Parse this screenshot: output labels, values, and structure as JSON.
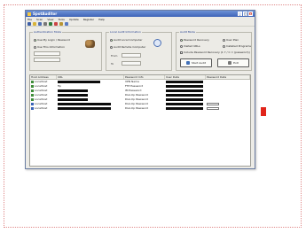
{
  "window": {
    "title": "SpotAuditor"
  },
  "menu": [
    "File",
    "Scan",
    "View",
    "Tools",
    "Update",
    "Register",
    "Help"
  ],
  "auth": {
    "title": "Authentication Mode",
    "opt_current": "Use My Login / Password",
    "opt_other": "Use This Information"
  },
  "audit": {
    "title": "Local Audit Information",
    "opt_local": "Audit Local Computer",
    "opt_remote": "Audit Remote Computer",
    "label_from": "From",
    "label_to": "To"
  },
  "mode": {
    "title": "Audit Mode",
    "opt_pwd": "Password Recovery",
    "opt_user": "User Plan",
    "opt_urls": "Visited URLs",
    "opt_installed": "Installed Programs",
    "opt_include": "Include Password Recovery  (1 Y / C  =  (password))",
    "start_btn": "Start Audit",
    "exit_btn": "Exit"
  },
  "table": {
    "columns": [
      "Host Address",
      "URL",
      "Password Info",
      "User Data",
      "Password Data"
    ],
    "rows": [
      {
        "host": "Localhost",
        "url": "",
        "info": "VPN Name",
        "pwd": ""
      },
      {
        "host": "Localhost",
        "url": "ftp",
        "info": "FTP Password",
        "pwd": ""
      },
      {
        "host": "Localhost",
        "url": "",
        "info": "IM Password",
        "pwd": ""
      },
      {
        "host": "Localhost",
        "url": "",
        "info": "Dial-Up Password",
        "pwd": ""
      },
      {
        "host": "Localhost",
        "url": "",
        "info": "Dial-Up Password",
        "pwd": ""
      },
      {
        "host": "Localhost",
        "url": "",
        "info": "Dial-Up Password",
        "pwd": "box"
      },
      {
        "host": "Localhost",
        "url": "",
        "info": "Dial-Up Password",
        "pwd": "box"
      }
    ]
  },
  "colors": {
    "accent": "#e1251b",
    "titlebar": "#3e63b8",
    "window_bg": "#ecebe6"
  },
  "icons": [
    "app-icon",
    "new-icon",
    "open-icon",
    "save-icon",
    "print-icon",
    "scan-icon",
    "stop-icon",
    "key-icon",
    "help-icon",
    "users-icon",
    "search-icon"
  ]
}
